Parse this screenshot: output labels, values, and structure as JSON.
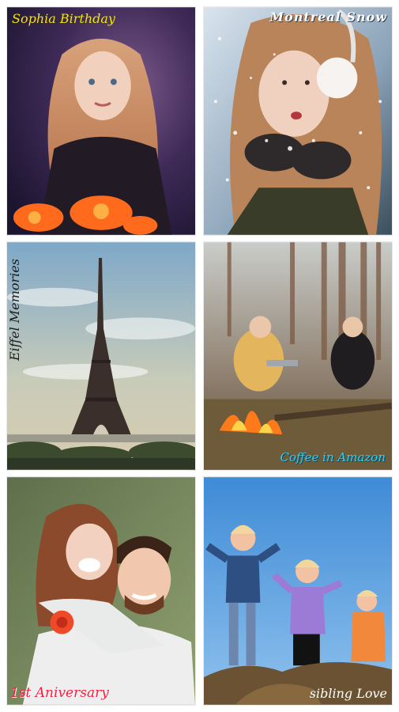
{
  "tiles": [
    {
      "caption": "Sophia Birthday",
      "color": "#f2e600",
      "scene": "girl-portrait"
    },
    {
      "caption": "Montreal Snow",
      "color": "#ffffff",
      "scene": "snow-winter"
    },
    {
      "caption": "Eiffel Memories",
      "color": "#1b1b1b",
      "scene": "eiffel-tower"
    },
    {
      "caption": "Coffee in Amazon",
      "color": "#27d3ff",
      "scene": "campfire-forest"
    },
    {
      "caption": "1st Aniversary",
      "color": "#ff1a3c",
      "scene": "couple-piggyback"
    },
    {
      "caption": "sibling Love",
      "color": "#ffffff",
      "scene": "three-kids-sky"
    }
  ]
}
